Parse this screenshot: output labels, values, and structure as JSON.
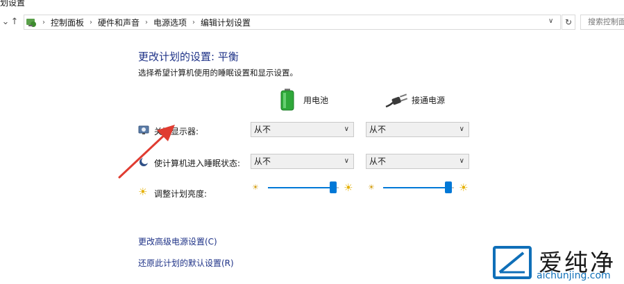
{
  "window": {
    "title_fragment": "划设置"
  },
  "navbar": {
    "down_glyph": "⌄",
    "up_glyph": "↑",
    "breadcrumbs": [
      "控制面板",
      "硬件和声音",
      "电源选项",
      "编辑计划设置"
    ],
    "breadcrumb_separator": "›",
    "dropdown_glyph": "∨",
    "refresh_glyph": "↻",
    "search_placeholder": "搜索控制面"
  },
  "main": {
    "title": "更改计划的设置: 平衡",
    "subtitle": "选择希望计算机使用的睡眠设置和显示设置。",
    "columns": {
      "battery": {
        "label": "用电池",
        "icon": "battery-icon"
      },
      "plugged": {
        "label": "接通电源",
        "icon": "power-plug-icon"
      }
    },
    "settings": {
      "display": {
        "label": "关闭显示器:",
        "icon": "display-icon",
        "battery_value": "从不",
        "plugged_value": "从不"
      },
      "sleep": {
        "label": "使计算机进入睡眠状态:",
        "icon": "moon-icon",
        "battery_value": "从不",
        "plugged_value": "从不"
      },
      "brightness": {
        "label": "调整计划亮度:",
        "icon": "sun-icon",
        "battery_level": 0.92,
        "plugged_level": 0.92
      }
    },
    "links": {
      "advanced": "更改高级电源设置(C)",
      "restore": "还原此计划的默认设置(R)"
    }
  },
  "watermark": {
    "brand": "爱纯净",
    "url": "aichunjing.com"
  },
  "colors": {
    "accent": "#0078d7",
    "title": "#1e3287",
    "arrow": "#e03c31",
    "brand": "#0f6fb8"
  }
}
